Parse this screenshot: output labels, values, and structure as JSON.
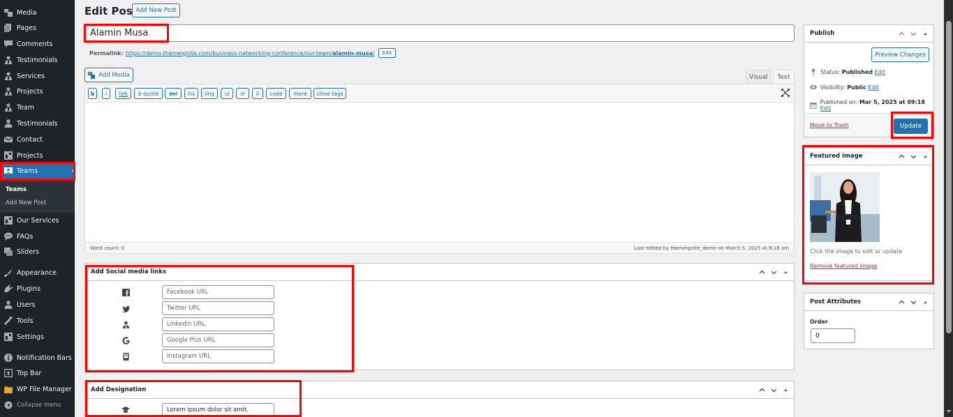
{
  "sidebar": {
    "items": [
      {
        "label": "Media",
        "icon": "media-icon"
      },
      {
        "label": "Pages",
        "icon": "pages-icon"
      },
      {
        "label": "Comments",
        "icon": "comments-icon"
      },
      {
        "label": "Testimonials",
        "icon": "person-icon"
      },
      {
        "label": "Services",
        "icon": "person-icon"
      },
      {
        "label": "Projects",
        "icon": "person-icon"
      },
      {
        "label": "Team",
        "icon": "person-icon"
      },
      {
        "label": "Testimonials",
        "icon": "user-icon"
      },
      {
        "label": "Contact",
        "icon": "mail-icon"
      },
      {
        "label": "Projects",
        "icon": "grid-icon"
      },
      {
        "label": "Teams",
        "icon": "teams-icon",
        "active": true
      },
      {
        "label": "Our Services",
        "icon": "grid-icon"
      },
      {
        "label": "FAQs",
        "icon": "chat-icon"
      },
      {
        "label": "Sliders",
        "icon": "slides-icon"
      },
      {
        "label": "Appearance",
        "icon": "brush-icon"
      },
      {
        "label": "Plugins",
        "icon": "plug-icon"
      },
      {
        "label": "Users",
        "icon": "user-icon"
      },
      {
        "label": "Tools",
        "icon": "wrench-icon"
      },
      {
        "label": "Settings",
        "icon": "grid-icon"
      },
      {
        "label": "Notification Bars",
        "icon": "info-icon"
      },
      {
        "label": "Top Bar",
        "icon": "topbar-icon"
      },
      {
        "label": "WP File Manager",
        "icon": "folder-icon"
      }
    ],
    "submenu": [
      {
        "label": "Teams",
        "current": true
      },
      {
        "label": "Add New Post"
      }
    ],
    "collapse_label": "Collapse menu"
  },
  "header": {
    "title": "Edit Post",
    "add_new_label": "Add New Post"
  },
  "post": {
    "title": "Alamin Musa",
    "permalink_label": "Permalink:",
    "permalink_base": "https://demo.themeignite.com/business-networking-conference/our-team/",
    "permalink_slug": "alamin-musa",
    "permalink_trailing": "/",
    "permalink_edit": "Edit"
  },
  "editor": {
    "add_media_label": "Add Media",
    "tabs": [
      "Visual",
      "Text"
    ],
    "active_tab": "Text",
    "quicktags": [
      "b",
      "i",
      "link",
      "b-quote",
      "del",
      "ins",
      "img",
      "ul",
      "ol",
      "li",
      "code",
      "more",
      "close tags"
    ],
    "content": "",
    "word_count": "Word count: 0",
    "last_edited": "Last edited by themeignite_demo on March 5, 2025 at 9:18 am"
  },
  "social_box": {
    "title": "Add Social media links",
    "fields": [
      {
        "icon": "facebook-icon",
        "placeholder": "Facebook URL",
        "value": ""
      },
      {
        "icon": "twitter-icon",
        "placeholder": "Twitter URL",
        "value": ""
      },
      {
        "icon": "linkedin-icon",
        "placeholder": "Linkedin URL",
        "value": ""
      },
      {
        "icon": "google-icon",
        "placeholder": "Google Plus URL",
        "value": ""
      },
      {
        "icon": "instagram-icon",
        "placeholder": "Instagram URL",
        "value": ""
      }
    ]
  },
  "designation_box": {
    "title": "Add Designation",
    "icon": "graduation-cap-icon",
    "value": "Lorem ipsum dolor sit amit."
  },
  "publish": {
    "title": "Publish",
    "preview_label": "Preview Changes",
    "status_label": "Status:",
    "status_value": "Published",
    "visibility_label": "Visibility:",
    "visibility_value": "Public",
    "published_label": "Published on:",
    "published_value": "Mar 5, 2025 at 09:18",
    "edit_label": "Edit",
    "trash_label": "Move to Trash",
    "update_label": "Update"
  },
  "featured_image": {
    "title": "Featured image",
    "hint": "Click the image to edit or update",
    "remove_label": "Remove featured image"
  },
  "post_attributes": {
    "title": "Post Attributes",
    "order_label": "Order",
    "order_value": "0"
  },
  "colors": {
    "accent": "#2271b1",
    "sidebar_bg": "#1d2327",
    "highlight": "#ff0000",
    "danger": "#b32d2e"
  }
}
